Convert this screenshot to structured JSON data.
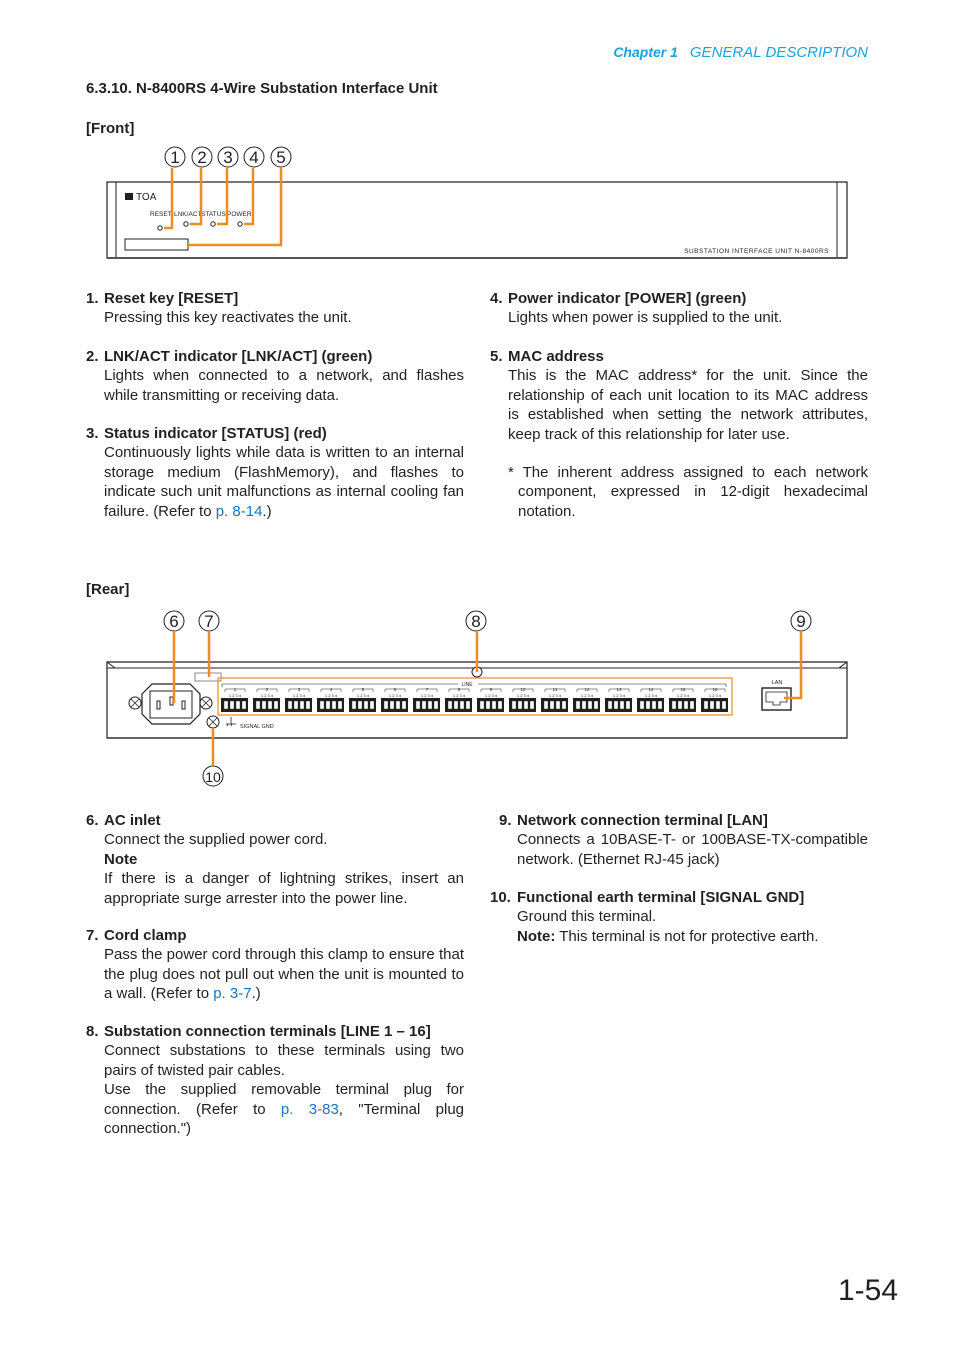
{
  "header": {
    "chapter": "Chapter 1",
    "title": "GENERAL DESCRIPTION"
  },
  "section_title": "6.3.10. N-8400RS 4-Wire Substation Interface Unit",
  "front": {
    "label": "[Front]",
    "callouts": [
      "1",
      "2",
      "3",
      "4",
      "5"
    ],
    "brand": "TOA",
    "panel_labels": [
      "RESET",
      "LNK/ACT",
      "STATUS",
      "POWER"
    ],
    "model_text": "SUBSTATION INTERFACE UNIT N-8400RS"
  },
  "front_items": [
    {
      "num": "1.",
      "title": "Reset key [RESET]",
      "body": "Pressing this key reactivates the unit."
    },
    {
      "num": "2.",
      "title": "LNK/ACT indicator [LNK/ACT] (green)",
      "body": "Lights when connected to a network, and flashes while transmitting or receiving data."
    },
    {
      "num": "3.",
      "title": "Status indicator [STATUS] (red)",
      "body_pre": "Continuously lights while data is written to an internal storage medium (FlashMemory), and flashes to indicate such unit malfunctions as internal cooling fan failure. (Refer to ",
      "link": "p. 8-14",
      "body_post": ".)"
    },
    {
      "num": "4.",
      "title": "Power indicator [POWER] (green)",
      "body": "Lights when power is supplied to the unit."
    },
    {
      "num": "5.",
      "title": "MAC address",
      "body": "This is the MAC address* for the unit. Since the relationship of each unit location to its MAC address is established when setting the network attributes, keep track of this relationship for later use.",
      "footnote": "* The inherent address assigned to each network component, expressed in 12-digit hexadecimal notation."
    }
  ],
  "rear": {
    "label": "[Rear]",
    "callouts": [
      "6",
      "7",
      "8",
      "9",
      "10"
    ],
    "line_label": "LINE",
    "lan_label": "LAN",
    "gnd_label": "SIGNAL GND",
    "terminal_numbers": [
      "1",
      "2",
      "3",
      "4",
      "5",
      "6",
      "7",
      "8",
      "9",
      "10",
      "11",
      "12",
      "13",
      "14",
      "15",
      "16"
    ],
    "pin_labels": "1 2 3 4"
  },
  "rear_items": [
    {
      "num": "6.",
      "title": "AC inlet",
      "body": "Connect the supplied power cord.",
      "note_label": "Note",
      "note": "If there is a danger of lightning strikes, insert an appropriate surge arrester into the power line."
    },
    {
      "num": "7.",
      "title": "Cord clamp",
      "body_pre": "Pass the power cord through this clamp to ensure that the plug does not pull out when the unit is mounted to a wall. (Refer to ",
      "link": "p. 3-7",
      "body_post": ".)"
    },
    {
      "num": "8.",
      "title": "Substation connection terminals [LINE 1 – 16]",
      "body": "Connect substations to these terminals using two pairs of twisted pair cables.",
      "body2_pre": "Use the supplied removable terminal plug for connection. (Refer to ",
      "link": "p. 3-83",
      "body2_post": ", \"Terminal plug connection.\")"
    },
    {
      "num": "9.",
      "title": "Network connection terminal [LAN]",
      "body": "Connects a 10BASE-T- or 100BASE-TX-compatible network. (Ethernet RJ-45 jack)"
    },
    {
      "num": "10.",
      "title": "Functional earth terminal [SIGNAL GND]",
      "body": "Ground this terminal.",
      "note_label": "Note:",
      "note": " This terminal is not for protective earth."
    }
  ],
  "page_number": "1-54",
  "colors": {
    "accent": "#1aa3dc",
    "callout_line": "#f08c1e",
    "link": "#1a73c0"
  }
}
